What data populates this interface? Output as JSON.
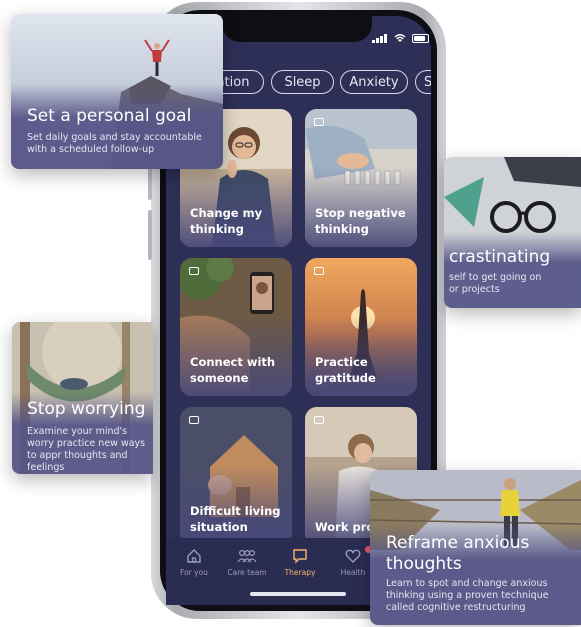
{
  "categories": [
    "ation",
    "Sleep",
    "Anxiety",
    "S"
  ],
  "tiles": [
    {
      "label": "Change my thinking",
      "bubble": false
    },
    {
      "label": "Stop negative thinking",
      "bubble": true
    },
    {
      "label": "Connect with someone",
      "bubble": true
    },
    {
      "label": "Practice gratitude",
      "bubble": true
    },
    {
      "label": "Difficult living situation",
      "bubble": true
    },
    {
      "label": "Work prob",
      "bubble": true
    }
  ],
  "bottom_nav": [
    {
      "label": "For you",
      "icon": "home-icon",
      "active": false
    },
    {
      "label": "Care team",
      "icon": "people-icon",
      "active": false
    },
    {
      "label": "Therapy",
      "icon": "chat-icon",
      "active": true
    },
    {
      "label": "Health",
      "icon": "heart-icon",
      "active": false
    }
  ],
  "cards": {
    "goal": {
      "title": "Set a personal goal",
      "desc": "Set daily goals and stay accountable with a scheduled follow-up"
    },
    "procrastinating": {
      "title": "crastinating",
      "desc": "self to get going on or projects"
    },
    "worrying": {
      "title": "Stop worrying",
      "desc": "Examine your mind's worry practice new ways to appr thoughts and feelings"
    },
    "reframe": {
      "title": "Reframe anxious thoughts",
      "desc": "Learn to spot and change anxious thinking using a proven technique called cognitive restructuring"
    }
  },
  "colors": {
    "screen_bg": "#2e2f57",
    "active_tab": "#f2b46b",
    "inactive_tab": "#9a9bc2",
    "notification_dot": "#e8576e"
  }
}
